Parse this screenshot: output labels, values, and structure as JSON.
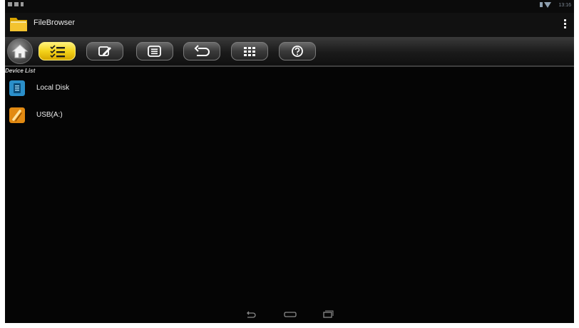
{
  "status_bar": {
    "clock": "13:16",
    "icons": [
      "notification-icon",
      "notification-icon",
      "notification-icon",
      "battery-icon",
      "wifi-icon"
    ]
  },
  "action_bar": {
    "app_icon": "folder-icon",
    "title": "FileBrowser",
    "overflow_icon": "overflow-menu-icon"
  },
  "toolbar": {
    "buttons": [
      {
        "name": "home",
        "icon": "home-icon"
      },
      {
        "name": "multi-select",
        "icon": "checklist-icon",
        "active": true
      },
      {
        "name": "edit",
        "icon": "edit-icon"
      },
      {
        "name": "list-view",
        "icon": "list-icon"
      },
      {
        "name": "back",
        "icon": "back-arrow-icon"
      },
      {
        "name": "grid-view",
        "icon": "grid-icon"
      },
      {
        "name": "help",
        "icon": "help-icon"
      }
    ],
    "accent_color": "#f3d21a"
  },
  "device_list": {
    "label": "Device List",
    "items": [
      {
        "label": "Local Disk",
        "icon": "local-disk-icon"
      },
      {
        "label": "USB(A:)",
        "icon": "usb-icon"
      }
    ]
  },
  "nav_bar": {
    "icons": [
      "back-icon",
      "home-icon",
      "recent-apps-icon"
    ]
  }
}
